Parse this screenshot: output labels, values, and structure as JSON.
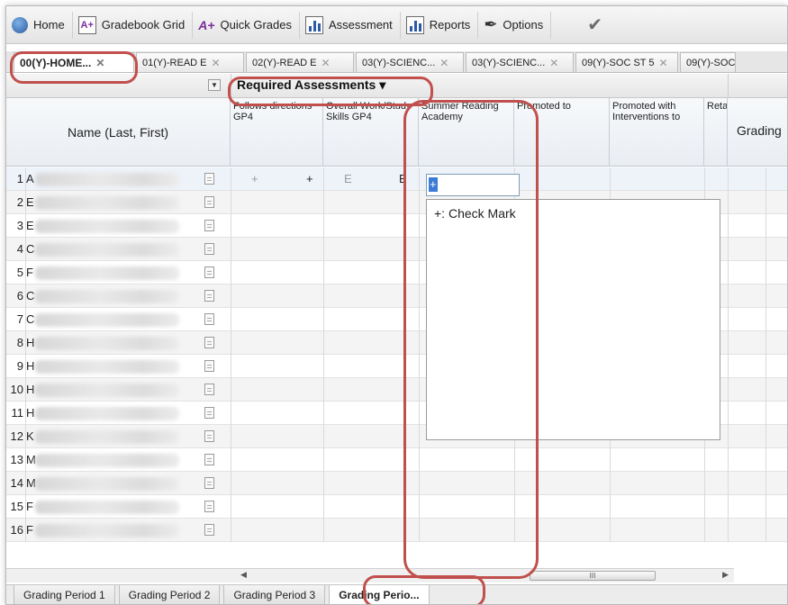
{
  "toolbar": {
    "items": [
      {
        "label": "Home",
        "icon": "home-globe-icon"
      },
      {
        "label": "Gradebook Grid",
        "icon": "gradebook-grid-icon"
      },
      {
        "label": "Quick Grades",
        "icon": "quick-grades-icon"
      },
      {
        "label": "Assessment",
        "icon": "assessment-chart-icon"
      },
      {
        "label": "Reports",
        "icon": "reports-chart-icon"
      },
      {
        "label": "Options",
        "icon": "options-pen-icon"
      }
    ]
  },
  "tabs": [
    {
      "label": "00(Y)-HOME...",
      "active": true
    },
    {
      "label": "01(Y)-READ E"
    },
    {
      "label": "02(Y)-READ E"
    },
    {
      "label": "03(Y)-SCIENC..."
    },
    {
      "label": "03(Y)-SCIENC..."
    },
    {
      "label": "09(Y)-SOC ST 5"
    },
    {
      "label": "09(Y)-SOC"
    }
  ],
  "grid": {
    "group_title": "Required Assessments",
    "name_header": "Name (Last, First)",
    "columns": [
      "Follows directions GP4",
      "Overall Work/Study Skills GP4",
      "Summer Reading Academy",
      "Promoted to",
      "Promoted with Interventions to",
      "Reta",
      "Grading"
    ],
    "rows": [
      {
        "num": "1",
        "initial": "A"
      },
      {
        "num": "2",
        "initial": "E"
      },
      {
        "num": "3",
        "initial": "E"
      },
      {
        "num": "4",
        "initial": "C"
      },
      {
        "num": "5",
        "initial": "F"
      },
      {
        "num": "6",
        "initial": "C"
      },
      {
        "num": "7",
        "initial": "C"
      },
      {
        "num": "8",
        "initial": "H"
      },
      {
        "num": "9",
        "initial": "H"
      },
      {
        "num": "10",
        "initial": "H"
      },
      {
        "num": "11",
        "initial": "H"
      },
      {
        "num": "12",
        "initial": "K"
      },
      {
        "num": "13",
        "initial": "M"
      },
      {
        "num": "14",
        "initial": "M"
      },
      {
        "num": "15",
        "initial": "F"
      },
      {
        "num": "16",
        "initial": "F"
      }
    ],
    "row1_values": {
      "follows_default": "+",
      "follows_value": "+",
      "overall_default": "E",
      "overall_value": "E"
    },
    "editor_value": "+",
    "dropdown_option": "+: Check Mark",
    "scroll_thumb_grip": "III"
  },
  "bottom_tabs": [
    {
      "label": "Grading Period 1"
    },
    {
      "label": "Grading Period 2"
    },
    {
      "label": "Grading Period 3"
    },
    {
      "label": "Grading Perio...",
      "active": true
    }
  ],
  "colors": {
    "annotation": "#c0504d",
    "selection": "#3a7bd5"
  }
}
